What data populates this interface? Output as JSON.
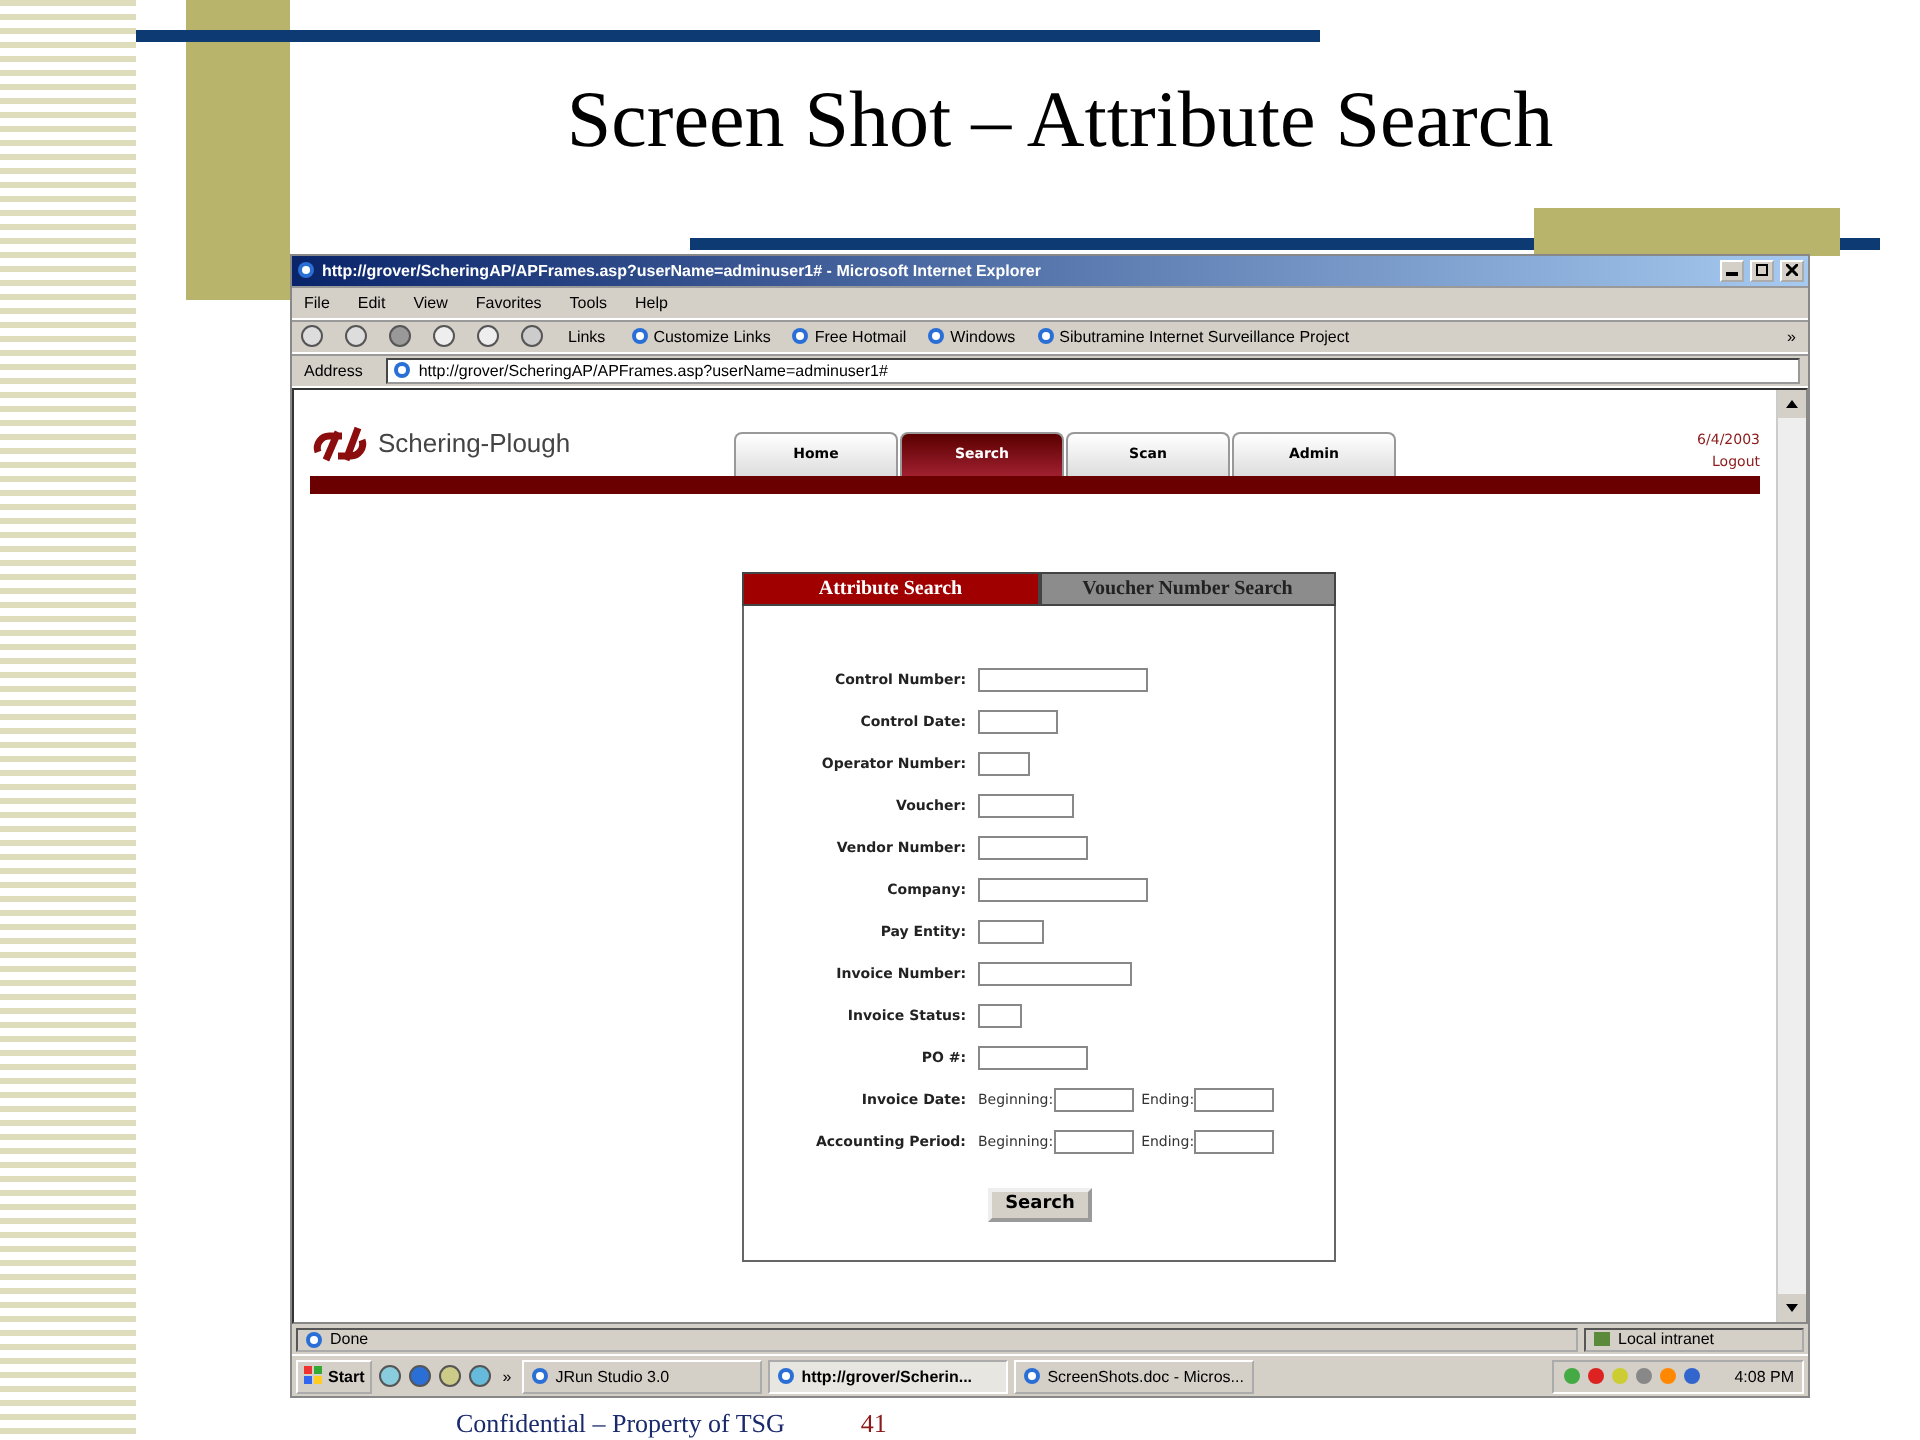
{
  "slide": {
    "title": "Screen Shot – Attribute Search",
    "footer": "Confidential – Property of TSG",
    "page_number": "41"
  },
  "browser": {
    "title": "http://grover/ScheringAP/APFrames.asp?userName=adminuser1# - Microsoft Internet Explorer",
    "menu": [
      "File",
      "Edit",
      "View",
      "Favorites",
      "Tools",
      "Help"
    ],
    "links_label": "Links",
    "links": [
      "Customize Links",
      "Free Hotmail",
      "Windows",
      "Sibutramine Internet Surveillance Project"
    ],
    "links_more": "»",
    "address_label": "Address",
    "address": "http://grover/ScheringAP/APFrames.asp?userName=adminuser1#",
    "status": "Done",
    "zone": "Local intranet"
  },
  "page": {
    "brand": "Schering-Plough",
    "nav": [
      {
        "label": "Home",
        "selected": false
      },
      {
        "label": "Search",
        "selected": true
      },
      {
        "label": "Scan",
        "selected": false
      },
      {
        "label": "Admin",
        "selected": false
      }
    ],
    "date": "6/4/2003",
    "logout": "Logout",
    "search_tabs": [
      {
        "label": "Attribute Search",
        "selected": true
      },
      {
        "label": "Voucher Number Search",
        "selected": false
      }
    ],
    "fields": [
      {
        "kind": "text",
        "label": "Control Number:"
      },
      {
        "kind": "text",
        "label": "Control Date:"
      },
      {
        "kind": "text",
        "label": "Operator Number:"
      },
      {
        "kind": "text",
        "label": "Voucher:"
      },
      {
        "kind": "text",
        "label": "Vendor Number:"
      },
      {
        "kind": "text",
        "label": "Company:"
      },
      {
        "kind": "text",
        "label": "Pay Entity:"
      },
      {
        "kind": "text",
        "label": "Invoice Number:"
      },
      {
        "kind": "text",
        "label": "Invoice Status:"
      },
      {
        "kind": "text",
        "label": "PO #:"
      },
      {
        "kind": "range",
        "label": "Invoice Date:",
        "begin_label": "Beginning:",
        "end_label": "Ending:"
      },
      {
        "kind": "range",
        "label": "Accounting Period:",
        "begin_label": "Beginning:",
        "end_label": "Ending:"
      }
    ],
    "button": "Search"
  },
  "taskbar": {
    "start": "Start",
    "quick_more": "»",
    "tasks": [
      {
        "label": "JRun Studio 3.0",
        "selected": false
      },
      {
        "label": "http://grover/Scherin...",
        "selected": true
      },
      {
        "label": "ScreenShots.doc - Micros...",
        "selected": false
      }
    ],
    "time": "4:08 PM"
  }
}
